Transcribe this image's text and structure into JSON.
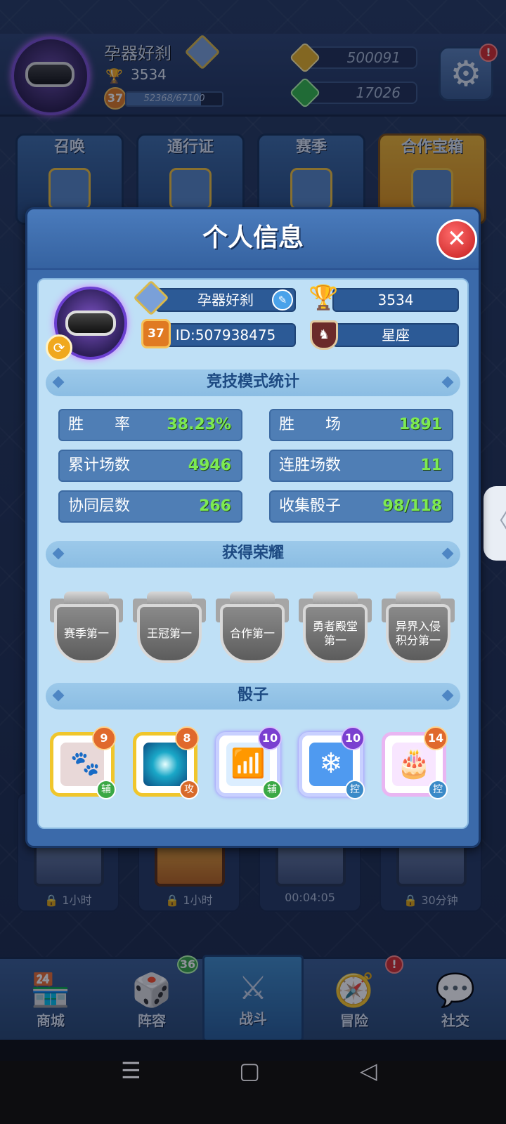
{
  "header": {
    "player_name": "孕器好刹",
    "trophies": "3534",
    "level": "37",
    "xp": "52368/67100",
    "xp_progress": 0.78,
    "coins": "500091",
    "gems": "17026",
    "settings_alert": "!"
  },
  "tiles": [
    {
      "label": "召唤"
    },
    {
      "label": "通行证"
    },
    {
      "label": "赛季"
    },
    {
      "label": "合作宝箱"
    }
  ],
  "chests": [
    {
      "label": "🔒 1小时"
    },
    {
      "label": "🔒 1小时"
    },
    {
      "label": "00:04:05"
    },
    {
      "label": "🔒 30分钟"
    }
  ],
  "nav": {
    "items": [
      {
        "label": "商城",
        "icon": "shop-icon"
      },
      {
        "label": "阵容",
        "icon": "dice-icon",
        "badge": "36"
      },
      {
        "label": "战斗",
        "icon": "swords-icon"
      },
      {
        "label": "冒险",
        "icon": "adventure-icon",
        "badge": "!"
      },
      {
        "label": "社交",
        "icon": "chat-icon"
      }
    ]
  },
  "modal": {
    "title": "个人信息",
    "name": "孕器好刹",
    "trophies": "3534",
    "level": "37",
    "id": "ID:507938475",
    "constellation": "星座",
    "stats_title": "竞技模式统计",
    "stats": [
      {
        "key": "胜　　率",
        "value": "38.23%"
      },
      {
        "key": "胜　　场",
        "value": "1891"
      },
      {
        "key": "累计场数",
        "value": "4946"
      },
      {
        "key": "连胜场数",
        "value": "11"
      },
      {
        "key": "协同层数",
        "value": "266"
      },
      {
        "key": "收集骰子",
        "value": "98/118"
      }
    ],
    "honors_title": "获得荣耀",
    "honors": [
      "赛季第一",
      "王冠第一",
      "合作第一",
      "勇者殿堂第一",
      "异界入侵积分第一"
    ],
    "dice_title": "骰子",
    "dice": [
      {
        "level": "9",
        "tag": "辅",
        "icon": "paw-icon"
      },
      {
        "level": "8",
        "tag": "攻",
        "icon": "vortex-icon"
      },
      {
        "level": "10",
        "tag": "辅",
        "icon": "signal-icon"
      },
      {
        "level": "10",
        "tag": "控",
        "icon": "snowflake-icon"
      },
      {
        "level": "14",
        "tag": "控",
        "icon": "cake-icon"
      }
    ]
  },
  "colors": {
    "accent_green": "#7dea52",
    "panel_blue": "#3b6aaa",
    "close_red": "#c41c1c"
  }
}
